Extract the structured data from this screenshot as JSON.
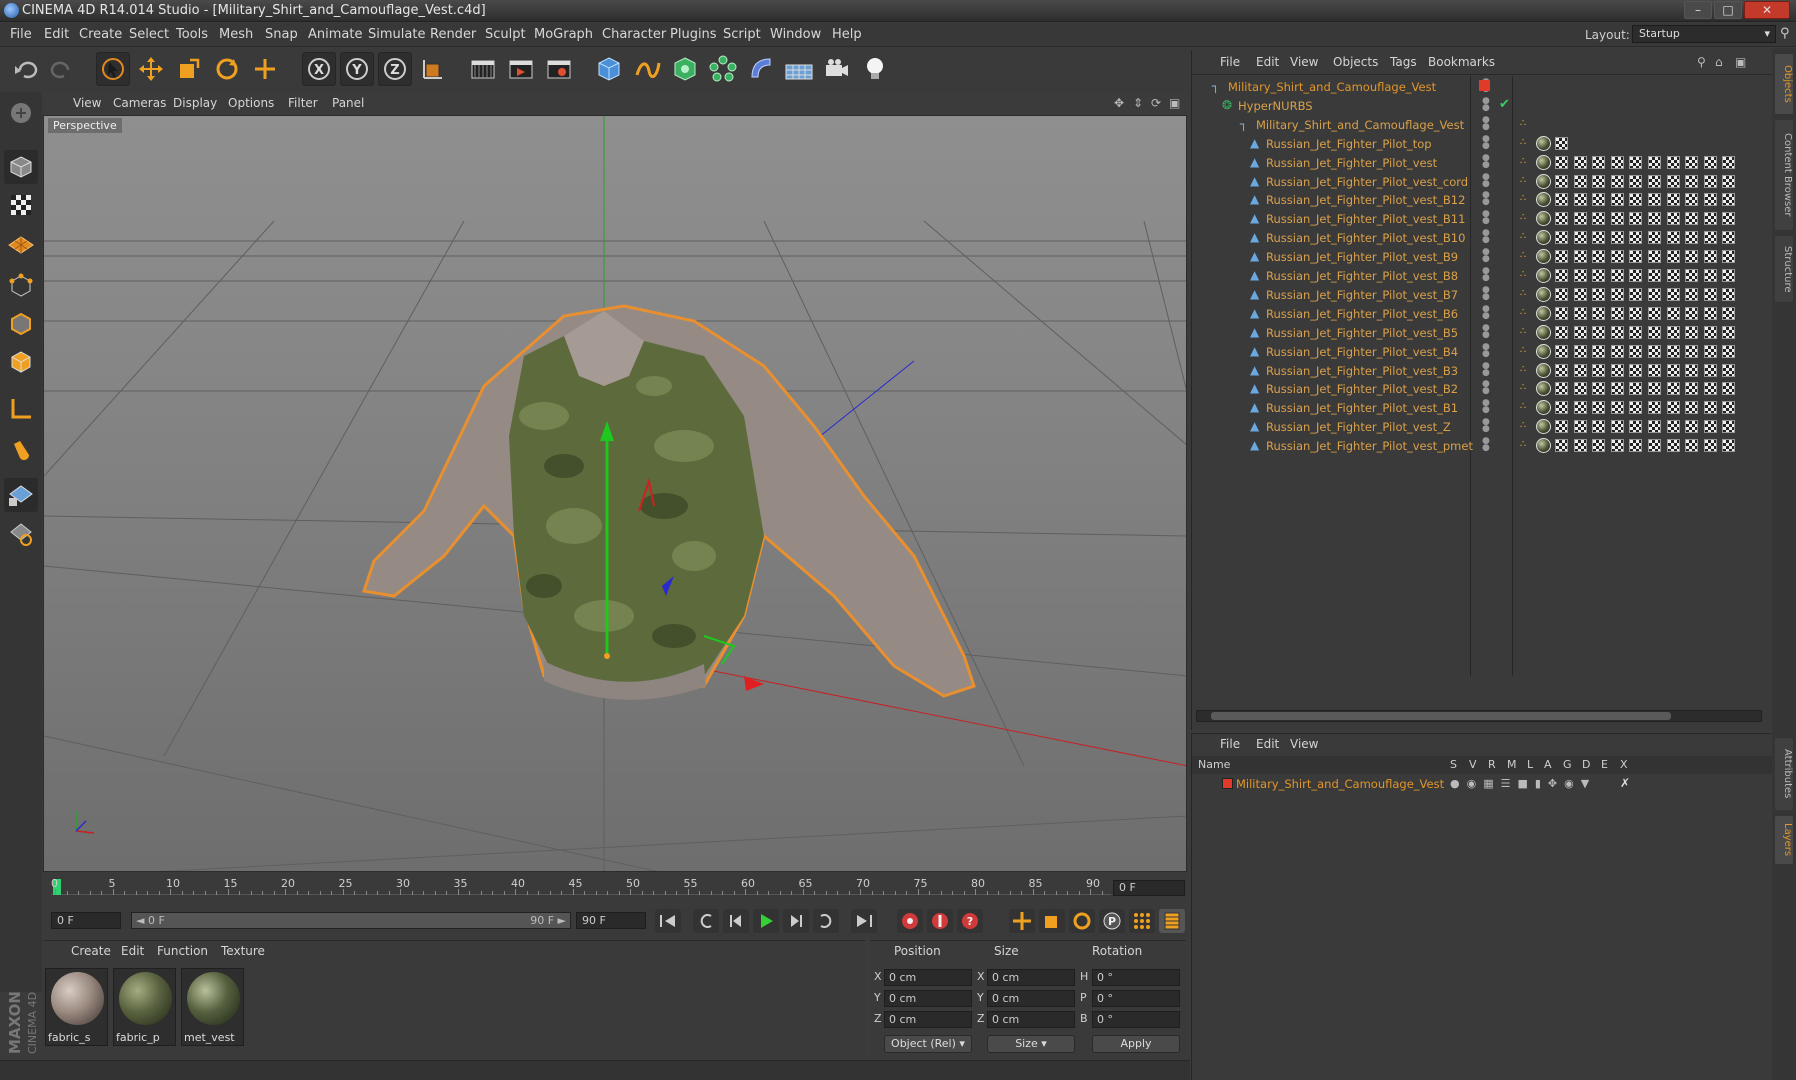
{
  "window": {
    "title": "CINEMA 4D R14.014 Studio - [Military_Shirt_and_Camouflage_Vest.c4d]"
  },
  "menubar": {
    "items": [
      "File",
      "Edit",
      "Create",
      "Select",
      "Tools",
      "Mesh",
      "Snap",
      "Animate",
      "Simulate",
      "Render",
      "Sculpt",
      "MoGraph",
      "Character",
      "Plugins",
      "Script",
      "Window",
      "Help"
    ],
    "layout_label": "Layout:",
    "layout_value": "Startup"
  },
  "viewport": {
    "menu": [
      "View",
      "Cameras",
      "Display",
      "Options",
      "Filter",
      "Panel"
    ],
    "label": "Perspective"
  },
  "timeline": {
    "ticks": [
      "0",
      "5",
      "10",
      "15",
      "20",
      "25",
      "30",
      "35",
      "40",
      "45",
      "50",
      "55",
      "60",
      "65",
      "70",
      "75",
      "80",
      "85",
      "90"
    ],
    "current_frame": "0 F"
  },
  "playbar": {
    "start_field": "0 F",
    "range_start": "◄ 0 F",
    "range_end": "90 F ►",
    "end_field": "90 F"
  },
  "material_manager": {
    "menu": [
      "Create",
      "Edit",
      "Function",
      "Texture"
    ],
    "materials": [
      {
        "name": "fabric_s",
        "color": "#9a8a80"
      },
      {
        "name": "fabric_p",
        "color": "#5a6340"
      },
      {
        "name": "met_vest",
        "color": "#55603f"
      }
    ]
  },
  "coordinates": {
    "headers": [
      "Position",
      "Size",
      "Rotation"
    ],
    "rows": [
      {
        "axis": "X",
        "pos": "0 cm",
        "size_axis": "X",
        "size": "0 cm",
        "rot_axis": "H",
        "rot": "0 °"
      },
      {
        "axis": "Y",
        "pos": "0 cm",
        "size_axis": "Y",
        "size": "0 cm",
        "rot_axis": "P",
        "rot": "0 °"
      },
      {
        "axis": "Z",
        "pos": "0 cm",
        "size_axis": "Z",
        "size": "0 cm",
        "rot_axis": "B",
        "rot": "0 °"
      }
    ],
    "mode_select": "Object (Rel)",
    "size_select": "Size",
    "apply": "Apply"
  },
  "object_manager": {
    "menu": [
      "File",
      "Edit",
      "View",
      "Objects",
      "Tags",
      "Bookmarks"
    ],
    "objects": [
      "Military_Shirt_and_Camouflage_Vest",
      "HyperNURBS",
      "Military_Shirt_and_Camouflage_Vest",
      "Russian_Jet_Fighter_Pilot_top",
      "Russian_Jet_Fighter_Pilot_vest",
      "Russian_Jet_Fighter_Pilot_vest_cord",
      "Russian_Jet_Fighter_Pilot_vest_B12",
      "Russian_Jet_Fighter_Pilot_vest_B11",
      "Russian_Jet_Fighter_Pilot_vest_B10",
      "Russian_Jet_Fighter_Pilot_vest_B9",
      "Russian_Jet_Fighter_Pilot_vest_B8",
      "Russian_Jet_Fighter_Pilot_vest_B7",
      "Russian_Jet_Fighter_Pilot_vest_B6",
      "Russian_Jet_Fighter_Pilot_vest_B5",
      "Russian_Jet_Fighter_Pilot_vest_B4",
      "Russian_Jet_Fighter_Pilot_vest_B3",
      "Russian_Jet_Fighter_Pilot_vest_B2",
      "Russian_Jet_Fighter_Pilot_vest_B1",
      "Russian_Jet_Fighter_Pilot_vest_Z",
      "Russian_Jet_Fighter_Pilot_vest_pmet"
    ]
  },
  "layer_manager": {
    "menu": [
      "File",
      "Edit",
      "View"
    ],
    "name_header": "Name",
    "columns": [
      "S",
      "V",
      "R",
      "M",
      "L",
      "A",
      "G",
      "D",
      "E",
      "X"
    ],
    "layer_name": "Military_Shirt_and_Camouflage_Vest"
  },
  "right_tabs": [
    "Objects",
    "Content Browser",
    "Structure",
    "Attributes",
    "Layers"
  ],
  "colors": {
    "accent": "#e0962a",
    "layer_red": "#e03a2a"
  }
}
